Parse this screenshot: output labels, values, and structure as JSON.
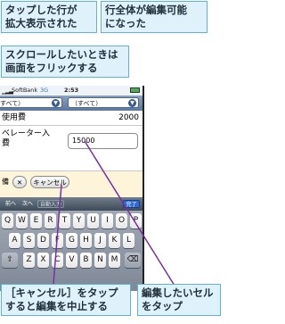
{
  "callouts": {
    "tapped_row": [
      "タップした行が",
      "拡大表示された"
    ],
    "editable": [
      "行全体が編集可能",
      "になった"
    ],
    "scroll": [
      "スクロールしたいときは",
      "画面をフリックする"
    ],
    "cancel": [
      "［キャンセル］をタップ",
      "すると編集を中止する"
    ],
    "edit_cell": [
      "編集したいセル",
      "をタップ"
    ]
  },
  "phone": {
    "status": {
      "carrier": "SoftBank",
      "network": "3G",
      "time": "2:53"
    },
    "nav": {
      "filter_left": "すべて）",
      "filter_right": "（すべて）"
    },
    "rows": {
      "row1_label": "使用費",
      "row1_value": "2000",
      "row2_label": [
        "ベレーター入",
        "費"
      ],
      "row2_input": "15000",
      "row3_left": "備",
      "cancel_button": "キャンセル"
    },
    "toolbar": {
      "prev": "前へ",
      "next": "次へ",
      "autofill": "自動入力",
      "done": "完了"
    },
    "keyboard": {
      "row1": [
        "Q",
        "W",
        "E",
        "R",
        "T",
        "Y",
        "U",
        "I",
        "O",
        "P"
      ],
      "row2": [
        "A",
        "S",
        "D",
        "F",
        "G",
        "H",
        "J",
        "K",
        "L"
      ],
      "row3": [
        "Z",
        "X",
        "C",
        "V",
        "B",
        "N",
        "M"
      ],
      "shift_icon": "shift-icon",
      "delete_icon": "delete-icon"
    }
  },
  "colors": {
    "callout_bg": "#dff1fb",
    "callout_border": "#5fb3d9",
    "leader_line": "#7a2fa0"
  }
}
